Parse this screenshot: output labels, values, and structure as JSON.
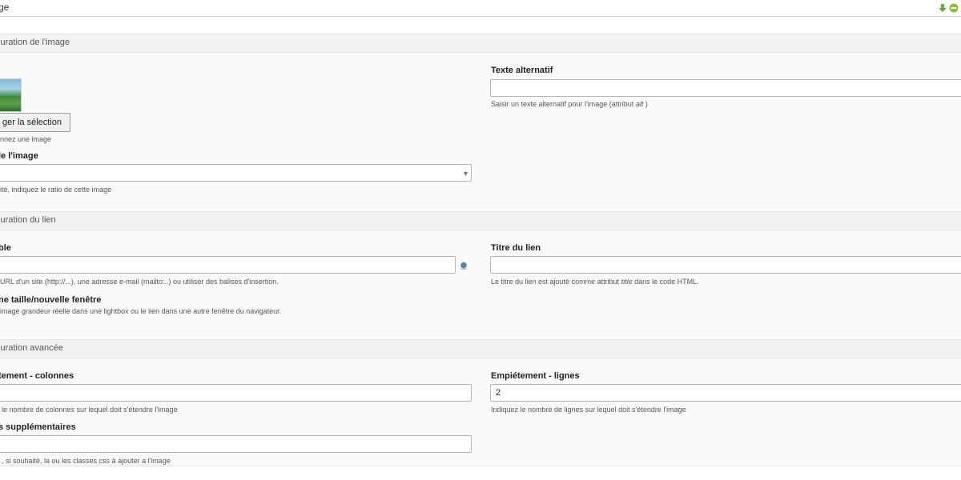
{
  "topbar": {
    "title": "ge",
    "icons": [
      "arrow-down-icon",
      "minus-circle-icon"
    ],
    "colors": {
      "arrow": "#5fae34",
      "minus": "#8cbd35"
    }
  },
  "sections": {
    "image": {
      "title": "iguration de l'image"
    },
    "link": {
      "title": "iguration du lien"
    },
    "advanced": {
      "title": "iguration avancée"
    }
  },
  "image_config": {
    "change_button": "ger la sélection",
    "image_hint": "nnez une image",
    "alt_label": "Texte alternatif",
    "alt_value": "",
    "alt_hint_before": "Saisir un texte alternatif pour l'image (attribut ",
    "alt_hint_em": "alt",
    "alt_hint_after": " )",
    "ratio_label": "le l'image",
    "ratio_value": "",
    "ratio_hint": "ité, indiquez le ratio de cette image"
  },
  "link_config": {
    "target_label": "ble",
    "target_value": "",
    "target_hint": "URL d'un site (http://...), une adresse e-mail (mailto:..) ou utiliser des balises d'insertion.",
    "title_label": "Titre du lien",
    "title_value": "",
    "title_hint_before": "Le titre du lien est ajouté comme attribut ",
    "title_hint_em": "title",
    "title_hint_after": " dans le code HTML.",
    "lightbox_label": "ne taille/nouvelle fenêtre",
    "lightbox_hint": "image grandeur réelle dans une lightbox ou le lien dans une autre fenêtre du navigateur."
  },
  "advanced_config": {
    "cols_label": "tement - colonnes",
    "cols_value": "",
    "cols_hint": "le nombre de colonnes sur lequel doit s'étendre l'image",
    "rows_label": "Empiétement - lignes",
    "rows_value": "2",
    "rows_hint": "Indiquez le nombre de lignes sur lequel doit s'étendre l'image",
    "css_label": "s supplémentaires",
    "css_value": "",
    "css_hint": ", si souhaité, la ou les classes css à ajouter a l'image"
  }
}
